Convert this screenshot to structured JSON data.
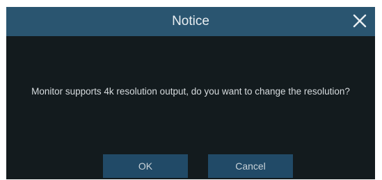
{
  "dialog": {
    "title": "Notice",
    "message": "Monitor supports 4k resolution output, do you want to change the resolution?",
    "close_icon": "close-icon",
    "ok_label": "OK",
    "cancel_label": "Cancel"
  },
  "colors": {
    "titlebar": "#2a5570",
    "body": "#131b1e",
    "button": "#214a67",
    "text": "#d6dbde"
  }
}
